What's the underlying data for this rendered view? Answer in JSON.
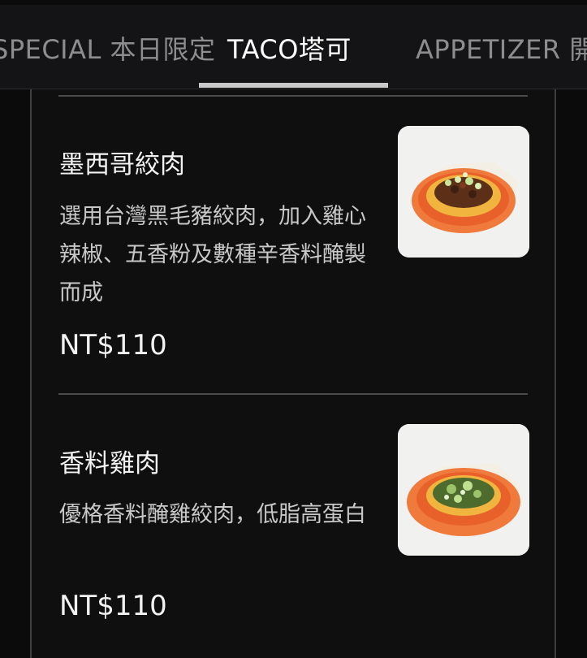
{
  "tabs": [
    {
      "label": "SPECIAL 本日限定",
      "active": false
    },
    {
      "label": "TACO塔可",
      "active": true
    },
    {
      "label": "APPETIZER 開胃菜",
      "active": false
    }
  ],
  "menu_items": [
    {
      "name": "墨西哥絞肉",
      "description": "選用台灣黑毛豬絞肉，加入雞心辣椒、五香粉及數種辛香料醃製而成",
      "price": "NT$110",
      "image_icon": "taco-ground-pork-photo"
    },
    {
      "name": "香料雞肉",
      "description": "優格香料醃雞絞肉，低脂高蛋白",
      "price": "NT$110",
      "image_icon": "taco-spiced-chicken-photo"
    }
  ],
  "colors": {
    "background": "#0b0b0c",
    "tab_bar": "#141416",
    "active_tab_text": "#ffffff",
    "inactive_tab_text": "#8d8d8f",
    "plate_orange": "#f07a3c"
  }
}
